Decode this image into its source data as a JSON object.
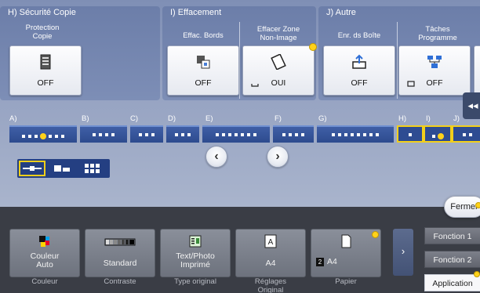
{
  "categories": [
    {
      "label": "H)  Sécurité Copie"
    },
    {
      "label": "I)   Effacement"
    },
    {
      "label": "J)   Autre"
    }
  ],
  "functions": [
    {
      "label": "Protection\nCopie",
      "value": "OFF",
      "icon": "copy-protect-icon"
    },
    {
      "label": "Effac. Bords",
      "value": "OFF",
      "icon": "frame-erase-icon"
    },
    {
      "label": "Effacer Zone\nNon-Image",
      "value": "OUI",
      "icon": "non-image-erase-icon"
    },
    {
      "label": "Enr. ds Boîte",
      "value": "OFF",
      "icon": "save-to-box-icon"
    },
    {
      "label": "Tâches\nProgramme",
      "value": "OFF",
      "icon": "program-jobs-icon"
    }
  ],
  "index_letters": [
    "A)",
    "B)",
    "C)",
    "D)",
    "E)",
    "F)",
    "G)",
    "H)",
    "I)",
    "J)"
  ],
  "nav": {
    "prev": "‹",
    "next": "›",
    "collapse": "◂◂"
  },
  "close_label": "Fermer",
  "quick_settings": [
    {
      "value": "Couleur\nAuto",
      "caption": "Couleur",
      "icon": "color-icon"
    },
    {
      "value": "Standard",
      "caption": "Contraste",
      "icon": "density-icon"
    },
    {
      "value": "Text/Photo\nImprimé",
      "caption": "Type original",
      "icon": "original-type-icon"
    },
    {
      "value": "A4",
      "caption": "Réglages\nOriginal",
      "icon": "original-settings-icon"
    },
    {
      "value": "A4",
      "caption": "Papier",
      "icon": "paper-icon",
      "tray": "2"
    }
  ],
  "side_tabs": [
    {
      "label": "Fonction 1"
    },
    {
      "label": "Fonction 2"
    },
    {
      "label": "Application"
    }
  ],
  "colors": {
    "accent_yellow": "#ffd21a",
    "panel_blue": "#2d4b8e",
    "bg": "#8c97b0"
  }
}
